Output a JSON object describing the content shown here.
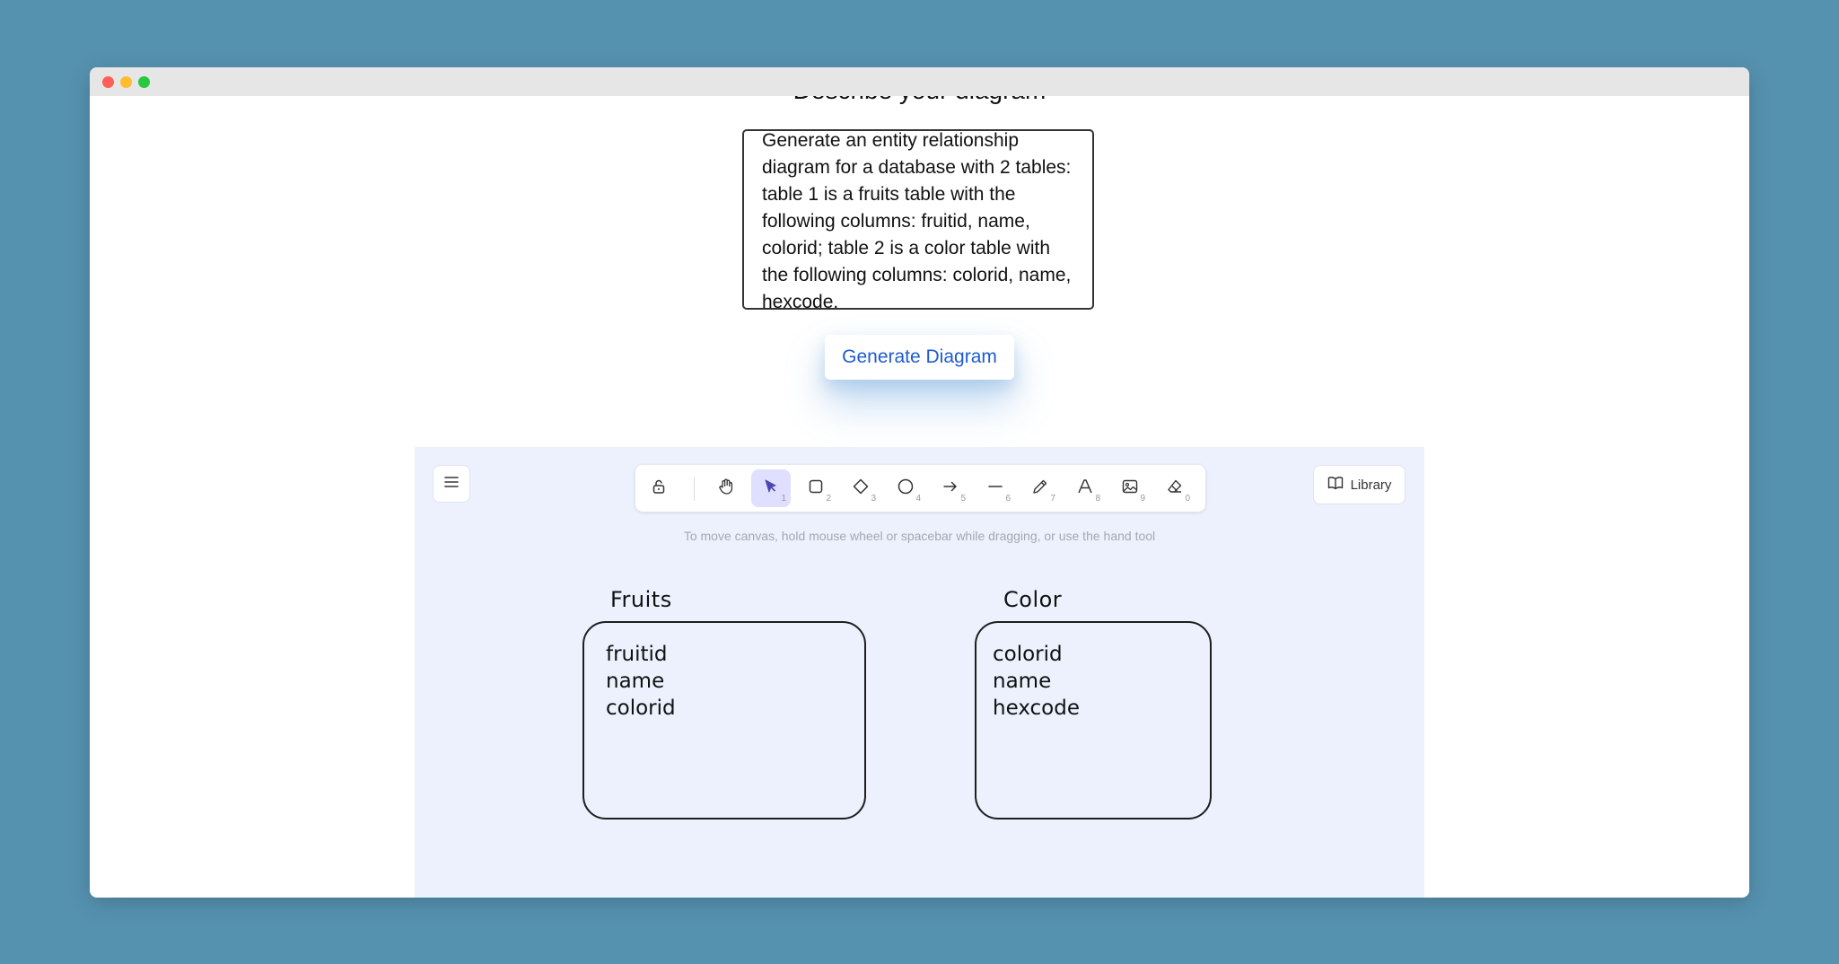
{
  "window": {
    "controls": [
      "close",
      "minimize",
      "maximize"
    ]
  },
  "page": {
    "heading": "Describe your diagram",
    "prompt_text": "Generate an entity relationship diagram for a database with 2 tables: table 1 is a fruits table with the following columns: fruitid, name, colorid; table 2 is a color table with the following columns: colorid, name, hexcode.",
    "generate_button_label": "Generate Diagram"
  },
  "canvas": {
    "library_label": "Library",
    "hint": "To move canvas, hold mouse wheel or spacebar while dragging, or use the hand tool",
    "tools": [
      {
        "name": "lock",
        "icon": "lock-icon",
        "shortcut": ""
      },
      {
        "name": "hand",
        "icon": "hand-icon",
        "shortcut": ""
      },
      {
        "name": "selection",
        "icon": "pointer-icon",
        "shortcut": "1",
        "active": true
      },
      {
        "name": "rectangle",
        "icon": "rectangle-icon",
        "shortcut": "2"
      },
      {
        "name": "diamond",
        "icon": "diamond-icon",
        "shortcut": "3"
      },
      {
        "name": "ellipse",
        "icon": "ellipse-icon",
        "shortcut": "4"
      },
      {
        "name": "arrow",
        "icon": "arrow-icon",
        "shortcut": "5"
      },
      {
        "name": "line",
        "icon": "line-icon",
        "shortcut": "6"
      },
      {
        "name": "draw",
        "icon": "pencil-icon",
        "shortcut": "7"
      },
      {
        "name": "text",
        "icon": "text-icon",
        "shortcut": "8"
      },
      {
        "name": "image",
        "icon": "image-icon",
        "shortcut": "9"
      },
      {
        "name": "eraser",
        "icon": "eraser-icon",
        "shortcut": "0"
      }
    ],
    "entities": [
      {
        "title": "Fruits",
        "columns": [
          "fruitid",
          "name",
          "colorid"
        ]
      },
      {
        "title": "Color",
        "columns": [
          "colorid",
          "name",
          "hexcode"
        ]
      }
    ]
  },
  "colors": {
    "background": "#5592b0",
    "canvas": "#ecf1fd",
    "accent": "#1d5bd1",
    "active_tool": "#e0dfff"
  }
}
